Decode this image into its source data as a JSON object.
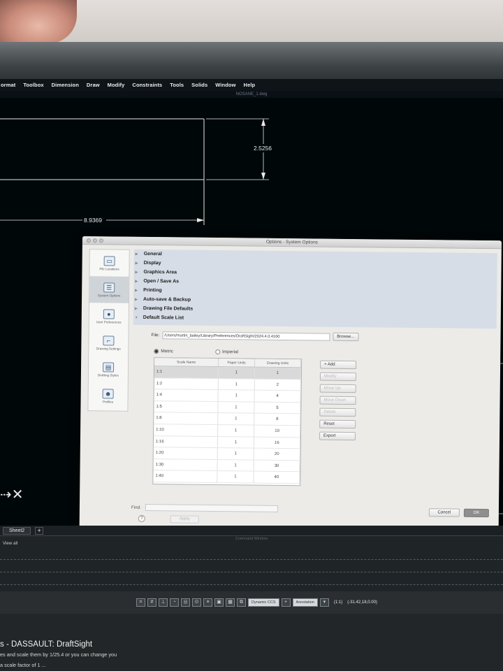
{
  "menubar": [
    "ormat",
    "Toolbox",
    "Dimension",
    "Draw",
    "Modify",
    "Constraints",
    "Tools",
    "Solids",
    "Window",
    "Help"
  ],
  "window_title": "NOSANE_1.dwg",
  "drawing": {
    "dim_vertical": "2.5256",
    "dim_horizontal": "8.9369"
  },
  "dialog": {
    "title": "Options - System Options",
    "sidebar": [
      {
        "label": "File Locations",
        "icon": "folder-icon"
      },
      {
        "label": "System Options",
        "icon": "list-icon"
      },
      {
        "label": "User Preferences",
        "icon": "user-gear-icon"
      },
      {
        "label": "Drawing Settings",
        "icon": "drawing-settings-icon"
      },
      {
        "label": "Drafting Styles",
        "icon": "drafting-styles-icon"
      },
      {
        "label": "Profiles",
        "icon": "profiles-icon"
      }
    ],
    "tree": [
      "General",
      "Display",
      "Graphics Area",
      "Open / Save As",
      "Printing",
      "Auto-save & Backup",
      "Drawing File Defaults",
      "Default Scale List"
    ],
    "file_label": "File:",
    "file_path": "/Users/martin_bailey/Library/Preferences/DraftSight/2024.4.0.4100",
    "browse_label": "Browse...",
    "radio_metric": "Metric",
    "radio_imperial": "Imperial",
    "table": {
      "headers": [
        "Scale Name",
        "Paper Units",
        "Drawing Units"
      ],
      "rows": [
        [
          "1:1",
          "1",
          "1"
        ],
        [
          "1:2",
          "1",
          "2"
        ],
        [
          "1:4",
          "1",
          "4"
        ],
        [
          "1:5",
          "1",
          "5"
        ],
        [
          "1:8",
          "1",
          "8"
        ],
        [
          "1:10",
          "1",
          "10"
        ],
        [
          "1:16",
          "1",
          "16"
        ],
        [
          "1:20",
          "1",
          "20"
        ],
        [
          "1:30",
          "1",
          "30"
        ],
        [
          "1:40",
          "1",
          "40"
        ]
      ]
    },
    "buttons": {
      "add": "+ Add",
      "modify": "Modify",
      "move_up": "Move Up",
      "move_down": "Move Down",
      "delete": "Delete",
      "reset": "Reset",
      "export": "Export"
    },
    "find_label": "Find:",
    "help": "?",
    "apply": "Apply",
    "cancel": "Cancel",
    "ok": "OK"
  },
  "sheet_tab": "Sheet2",
  "sheet_add": "+",
  "command_window_title": "Command Window",
  "command_line": "View all",
  "status": {
    "dynamic_ccs": "Dynamic CCS",
    "annotation": "Annotation",
    "scale": "(1:1)",
    "coords": "(-31.42,18,0.00)"
  },
  "page": {
    "title": "s - DASSAULT: DraftSight",
    "line1": "es and scale them by 1/25.4 or you can change you",
    "line2": "a scale factor of 1 ..."
  }
}
